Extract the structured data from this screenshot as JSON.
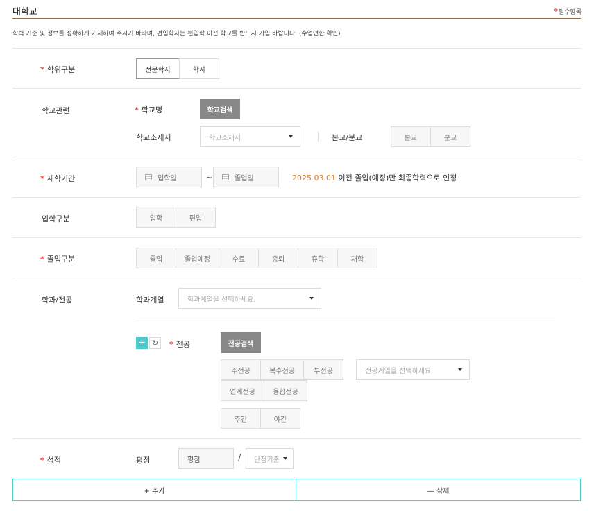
{
  "header": {
    "title": "대학교",
    "required_mark": "*",
    "required_text": "필수항목"
  },
  "notice": "학력 기준 및 정보를 정확하게 기재하여 주시기 바라며, 편입학자는 편입학 이전 학교를 반드시 기입 바랍니다. (수업연한 확인)",
  "degree": {
    "label": "학위구분",
    "options": [
      "전문학사",
      "학사"
    ]
  },
  "school": {
    "label": "학교관련",
    "name_label": "학교명",
    "search_button": "학교검색",
    "location_label": "학교소재지",
    "location_placeholder": "학교소재지",
    "campus_label": "본교/분교",
    "campus_options": [
      "본교",
      "분교"
    ]
  },
  "period": {
    "label": "재학기간",
    "start_placeholder": "입학일",
    "tilde": "~",
    "end_placeholder": "졸업일",
    "note_date": "2025.03.01",
    "note_text": " 이전 졸업(예정)만 최종학력으로 인정"
  },
  "admission": {
    "label": "입학구분",
    "options": [
      "입학",
      "편입"
    ]
  },
  "graduation": {
    "label": "졸업구분",
    "options": [
      "졸업",
      "졸업예정",
      "수료",
      "중퇴",
      "휴학",
      "재학"
    ]
  },
  "major": {
    "label": "학과/전공",
    "field_label": "학과계열",
    "field_placeholder": "학과계열을 선택하세요.",
    "plus": "+",
    "refresh": "↻",
    "major_label": "전공",
    "search_button": "전공검색",
    "type_options": [
      "주전공",
      "복수전공",
      "부전공",
      "연계전공",
      "융합전공"
    ],
    "category_placeholder": "전공계열을 선택하세요.",
    "time_options": [
      "주간",
      "야간"
    ]
  },
  "grade": {
    "label": "성적",
    "gpa_label": "평점",
    "gpa_placeholder": "평점",
    "slash": "/",
    "max_placeholder": "만점기준"
  },
  "footer": {
    "add_button": "+ 추가",
    "delete_button": "— 삭제"
  },
  "colors": {
    "accent": "#4ec8c8",
    "required": "#e0383e",
    "date_note": "#e07b1c",
    "header_rule": "#8b6b4a"
  }
}
